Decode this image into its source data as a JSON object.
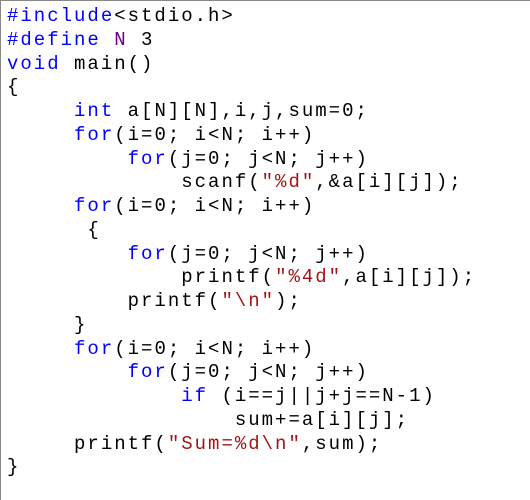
{
  "c": {
    "pp_include": "#include",
    "hdr_stdio": "<stdio.h>",
    "pp_define": "#define",
    "macro_N": "N",
    "macro_val": "3",
    "kw_void": "void",
    "fn_main": "main",
    "paren_empty": "()",
    "lbrace": "{",
    "rbrace": "}",
    "kw_int": "int",
    "decl_rest": " a[N][N],i,j,sum=0;",
    "kw_for": "for",
    "for_i": "(i=0; i<N; i++)",
    "for_j": "(j=0; j<N; j++)",
    "scanf_call_a": "scanf(",
    "scanf_fmt": "\"%d\"",
    "scanf_call_b": ",&a[i][j]);",
    "printf_cell_a": "printf(",
    "printf_cell_fmt": "\"%4d\"",
    "printf_cell_b": ",a[i][j]);",
    "printf_nl_a": "printf(",
    "printf_nl_fmt": "\"\\n\"",
    "printf_nl_b": ");",
    "kw_if": "if",
    "if_cond": " (i==j||j+j==N-1)",
    "sum_stmt": "sum+=a[i][j];",
    "printf_sum_a": "printf(",
    "printf_sum_fmt": "\"Sum=%d\\n\"",
    "printf_sum_b": ",sum);"
  }
}
